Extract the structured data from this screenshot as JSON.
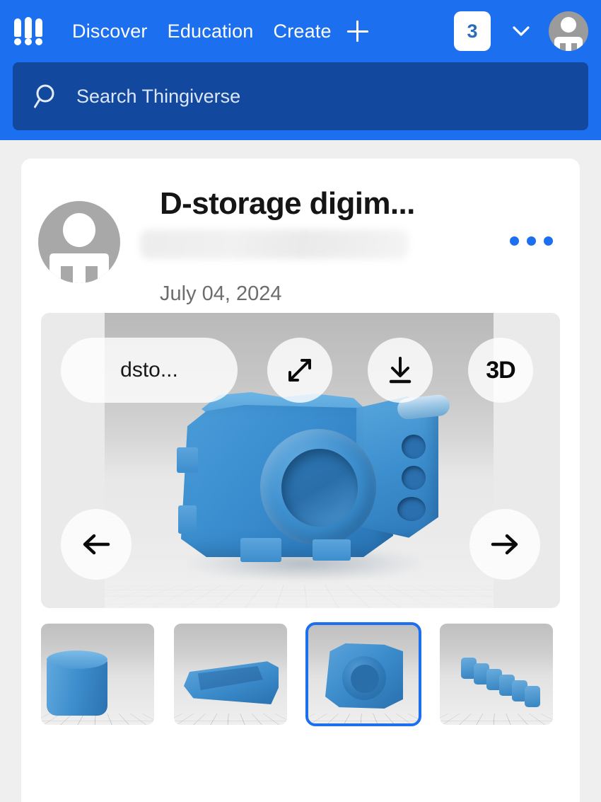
{
  "header": {
    "logo_name": "thingiverse-logo",
    "nav": [
      {
        "label": "Discover",
        "name": "nav-discover"
      },
      {
        "label": "Education",
        "name": "nav-education"
      },
      {
        "label": "Create",
        "name": "nav-create"
      }
    ],
    "create_plus_icon": "plus-icon",
    "notification_count": "3",
    "chevron_icon": "chevron-down-icon",
    "avatar_icon": "user-avatar",
    "colors": {
      "header_bg": "#1c6fee",
      "search_bg": "#12499f",
      "accent": "#1c6fee",
      "page_bg": "#efefef"
    }
  },
  "search": {
    "icon": "search-icon",
    "placeholder": "Search Thingiverse",
    "value": ""
  },
  "thing": {
    "title": "D-storage digim...",
    "author_name": "",
    "author_redacted": true,
    "date": "July 04, 2024",
    "more_menu_label": "•••"
  },
  "viewer": {
    "file_pill_label": "dsto...",
    "expand_icon": "expand-arrows-icon",
    "download_icon": "download-icon",
    "badge_3d_label": "3D",
    "prev_arrow_icon": "arrow-left-icon",
    "next_arrow_icon": "arrow-right-icon",
    "model_description": "blue 3D printed camera body model on print bed"
  },
  "thumbnails": {
    "selected_index": 2,
    "items": [
      {
        "name": "thumbnail-1",
        "alt": "blue cylindrical part"
      },
      {
        "name": "thumbnail-2",
        "alt": "blue elongated tray part"
      },
      {
        "name": "thumbnail-3",
        "alt": "blue camera body part"
      },
      {
        "name": "thumbnail-4",
        "alt": "row of small blue pegs"
      }
    ]
  }
}
